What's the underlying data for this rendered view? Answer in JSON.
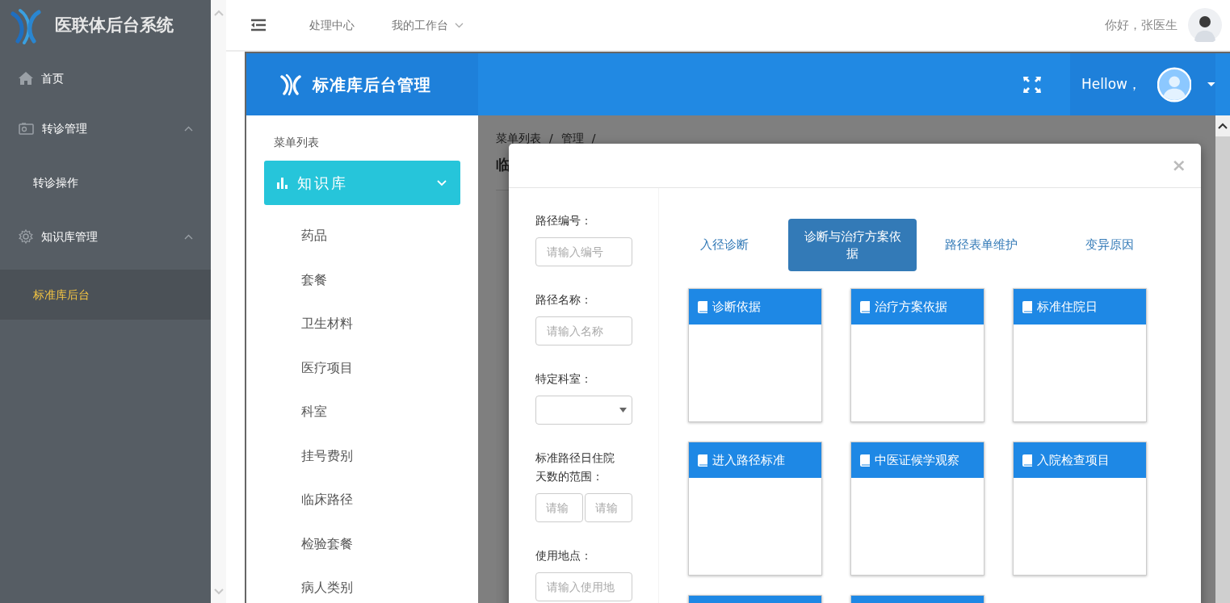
{
  "sidebar": {
    "title": "医联体后台系统",
    "items": [
      {
        "label": "首页",
        "kind": "home",
        "selected": false
      },
      {
        "label": "转诊管理",
        "kind": "transfer",
        "expanded": true,
        "selected": false,
        "children": [
          {
            "label": "转诊操作",
            "selected": false
          }
        ]
      },
      {
        "label": "知识库管理",
        "kind": "gear",
        "expanded": true,
        "selected": false,
        "children": [
          {
            "label": "标准库后台",
            "selected": true
          }
        ]
      }
    ]
  },
  "topbar": {
    "links": [
      {
        "label": "处理中心",
        "dropdown": false
      },
      {
        "label": "我的工作台",
        "dropdown": true
      }
    ],
    "greeting": "你好，张医生"
  },
  "app_header": {
    "title": "标准库后台管理",
    "user_greeting": "Hellow，"
  },
  "menu_panel": {
    "heading": "菜单列表",
    "group": {
      "label": "知识库",
      "expanded": true
    },
    "items": [
      {
        "label": "药品"
      },
      {
        "label": "套餐"
      },
      {
        "label": "卫生材料"
      },
      {
        "label": "医疗项目"
      },
      {
        "label": "科室"
      },
      {
        "label": "挂号费别"
      },
      {
        "label": "临床路径"
      },
      {
        "label": "检验套餐"
      },
      {
        "label": "病人类别"
      }
    ]
  },
  "content": {
    "breadcrumbs": [
      {
        "label": "菜单列表",
        "separator": "/"
      },
      {
        "label": "管理",
        "separator": "/"
      }
    ],
    "title": "临"
  },
  "modal": {
    "close": "×",
    "fields": [
      {
        "label": "路径编号：",
        "kind": "text",
        "placeholders": [
          "请输入编号"
        ]
      },
      {
        "label": "路径名称：",
        "kind": "text",
        "placeholders": [
          "请输入名称"
        ]
      },
      {
        "label": "特定科室：",
        "kind": "select"
      },
      {
        "label": "标准路径日住院天数的范围：",
        "kind": "range",
        "placeholders": [
          "请输",
          "请输"
        ]
      },
      {
        "label": "使用地点：",
        "kind": "text",
        "placeholders": [
          "请输入使用地"
        ]
      }
    ],
    "tabs": [
      {
        "label": "入径诊断",
        "selected": false
      },
      {
        "label": "诊断与治疗方案依据",
        "selected": true
      },
      {
        "label": "路径表单维护",
        "selected": false
      },
      {
        "label": "变异原因",
        "selected": false
      }
    ],
    "cards": [
      {
        "kind": "titled",
        "title": "诊断依据"
      },
      {
        "kind": "titled",
        "title": "治疗方案依据"
      },
      {
        "kind": "titled",
        "title": "标准住院日"
      },
      {
        "kind": "titled",
        "title": "进入路径标准"
      },
      {
        "kind": "titled",
        "title": "中医证候学观察"
      },
      {
        "kind": "titled",
        "title": "入院检查项目"
      },
      {
        "kind": "cut"
      },
      {
        "kind": "cut"
      }
    ]
  }
}
